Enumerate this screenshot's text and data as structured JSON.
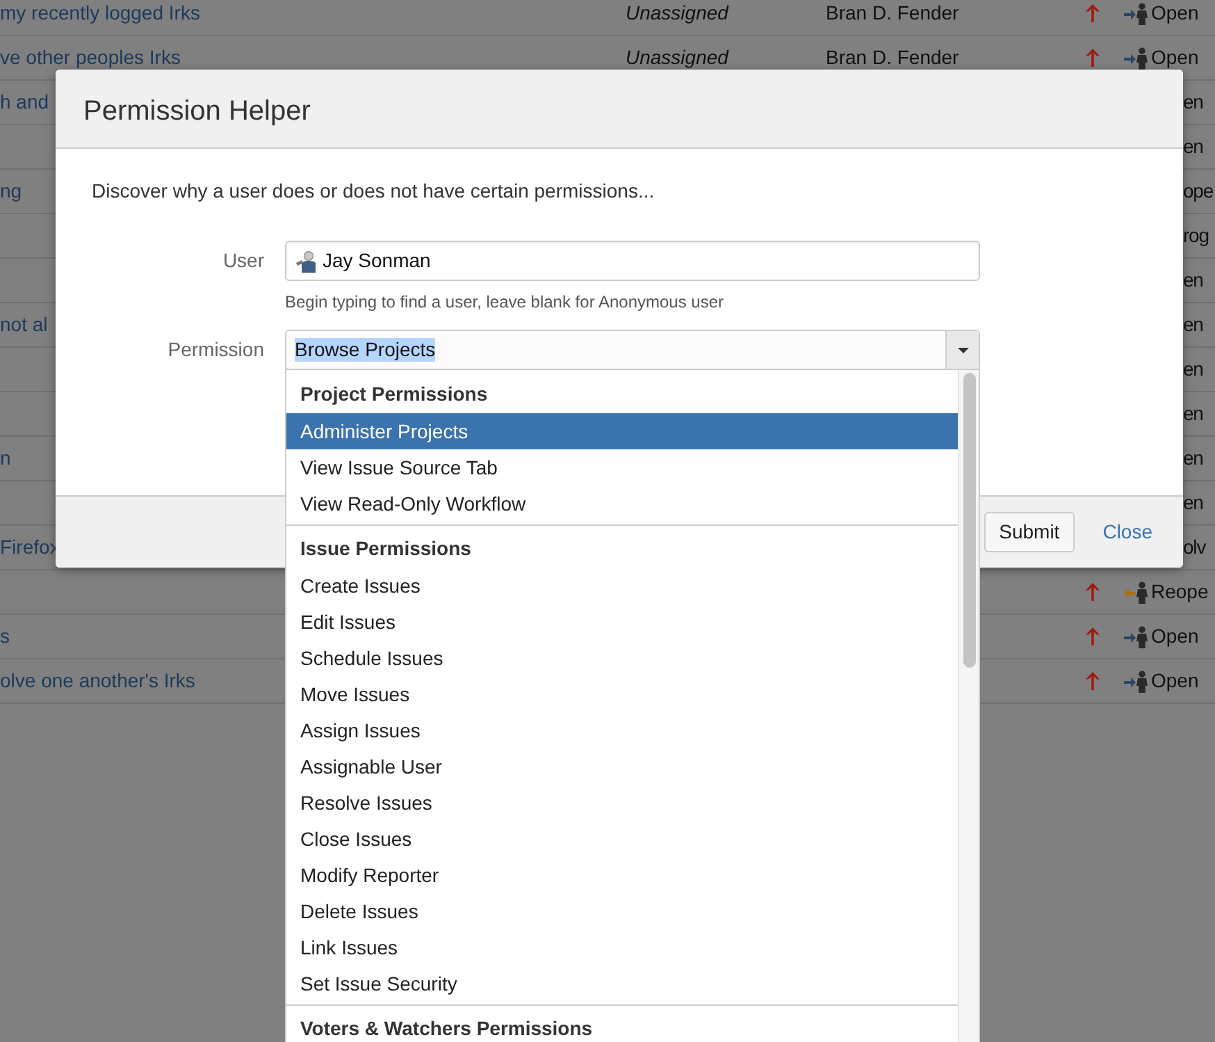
{
  "background_table": {
    "rows": [
      {
        "summary": "my recently logged Irks",
        "assignee": "Unassigned",
        "reporter": "Bran D. Fender",
        "priority": {
          "kind": "high"
        },
        "status": {
          "kind": "open",
          "text": "Open"
        }
      },
      {
        "summary": "ve other peoples Irks",
        "assignee": "Unassigned",
        "reporter": "Bran D. Fender",
        "priority": {
          "kind": "high"
        },
        "status": {
          "kind": "open",
          "text": "Open"
        }
      },
      {
        "summary": "h and",
        "status": {
          "text": "en"
        }
      },
      {
        "status": {
          "text": "en"
        }
      },
      {
        "summary": "ng",
        "status": {
          "text": "ope"
        }
      },
      {
        "status": {
          "text": "rog"
        }
      },
      {
        "status": {
          "text": "en"
        }
      },
      {
        "summary": "not al",
        "status": {
          "text": "en"
        }
      },
      {
        "status": {
          "text": "en"
        }
      },
      {
        "status": {
          "text": "en"
        }
      },
      {
        "summary": "n",
        "status": {
          "text": "en"
        }
      },
      {
        "status": {
          "text": "en"
        }
      },
      {
        "summary": "Firefox",
        "status": {
          "text": "olv"
        }
      },
      {
        "priority": {
          "kind": "high"
        },
        "status": {
          "kind": "reopened",
          "text": "Reope"
        }
      },
      {
        "summary": "s",
        "priority": {
          "kind": "high"
        },
        "status": {
          "kind": "open",
          "text": "Open"
        }
      },
      {
        "summary": "olve one another's Irks",
        "priority": {
          "kind": "high"
        },
        "status": {
          "kind": "open",
          "text": "Open"
        }
      }
    ]
  },
  "dialog": {
    "title": "Permission Helper",
    "description": "Discover why a user does or does not have certain permissions...",
    "user_field": {
      "label": "User",
      "value": "Jay Sonman",
      "help_text": "Begin typing to find a user, leave blank for Anonymous user"
    },
    "permission_field": {
      "label": "Permission",
      "value": "Browse Projects",
      "text_selected": true,
      "expanded": true
    },
    "buttons": [
      {
        "label": "Submit",
        "kind": "button"
      },
      {
        "label": "Close",
        "kind": "link"
      }
    ]
  },
  "permission_dropdown": {
    "groups": [
      {
        "heading": "Project Permissions",
        "items": [
          {
            "label": "Administer Projects",
            "selected": true
          },
          {
            "label": "View Issue Source Tab",
            "selected": false
          },
          {
            "label": "View Read-Only Workflow",
            "selected": false
          }
        ]
      },
      {
        "heading": "Issue Permissions",
        "items": [
          {
            "label": "Create Issues",
            "selected": false
          },
          {
            "label": "Edit Issues",
            "selected": false
          },
          {
            "label": "Schedule Issues",
            "selected": false
          },
          {
            "label": "Move Issues",
            "selected": false
          },
          {
            "label": "Assign Issues",
            "selected": false
          },
          {
            "label": "Assignable User",
            "selected": false
          },
          {
            "label": "Resolve Issues",
            "selected": false
          },
          {
            "label": "Close Issues",
            "selected": false
          },
          {
            "label": "Modify Reporter",
            "selected": false
          },
          {
            "label": "Delete Issues",
            "selected": false
          },
          {
            "label": "Link Issues",
            "selected": false
          },
          {
            "label": "Set Issue Security",
            "selected": false
          }
        ]
      },
      {
        "heading": "Voters & Watchers Permissions"
      }
    ]
  }
}
